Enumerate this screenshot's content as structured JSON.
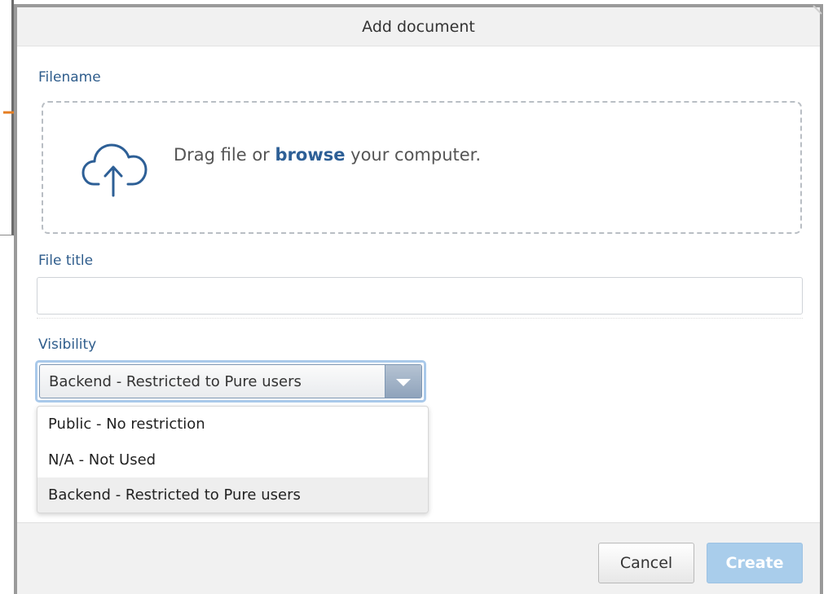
{
  "dialog": {
    "title": "Add document"
  },
  "form": {
    "filename_label": "Filename",
    "dropzone": {
      "prefix": "Drag file or ",
      "link": "browse",
      "suffix": " your computer."
    },
    "file_title_label": "File title",
    "file_title_value": "",
    "visibility_label": "Visibility",
    "visibility_selected": "Backend - Restricted to Pure users",
    "visibility_options": [
      "Public - No restriction",
      "N/A - Not Used",
      "Backend - Restricted to Pure users"
    ]
  },
  "footer": {
    "cancel_label": "Cancel",
    "create_label": "Create"
  },
  "colors": {
    "accent": "#2d5f96",
    "annotation_arrow": "#e67e22",
    "create_button": "#a9cdeb"
  },
  "icons": {
    "upload": "cloud-upload-icon",
    "dropdown": "chevron-down-icon"
  }
}
